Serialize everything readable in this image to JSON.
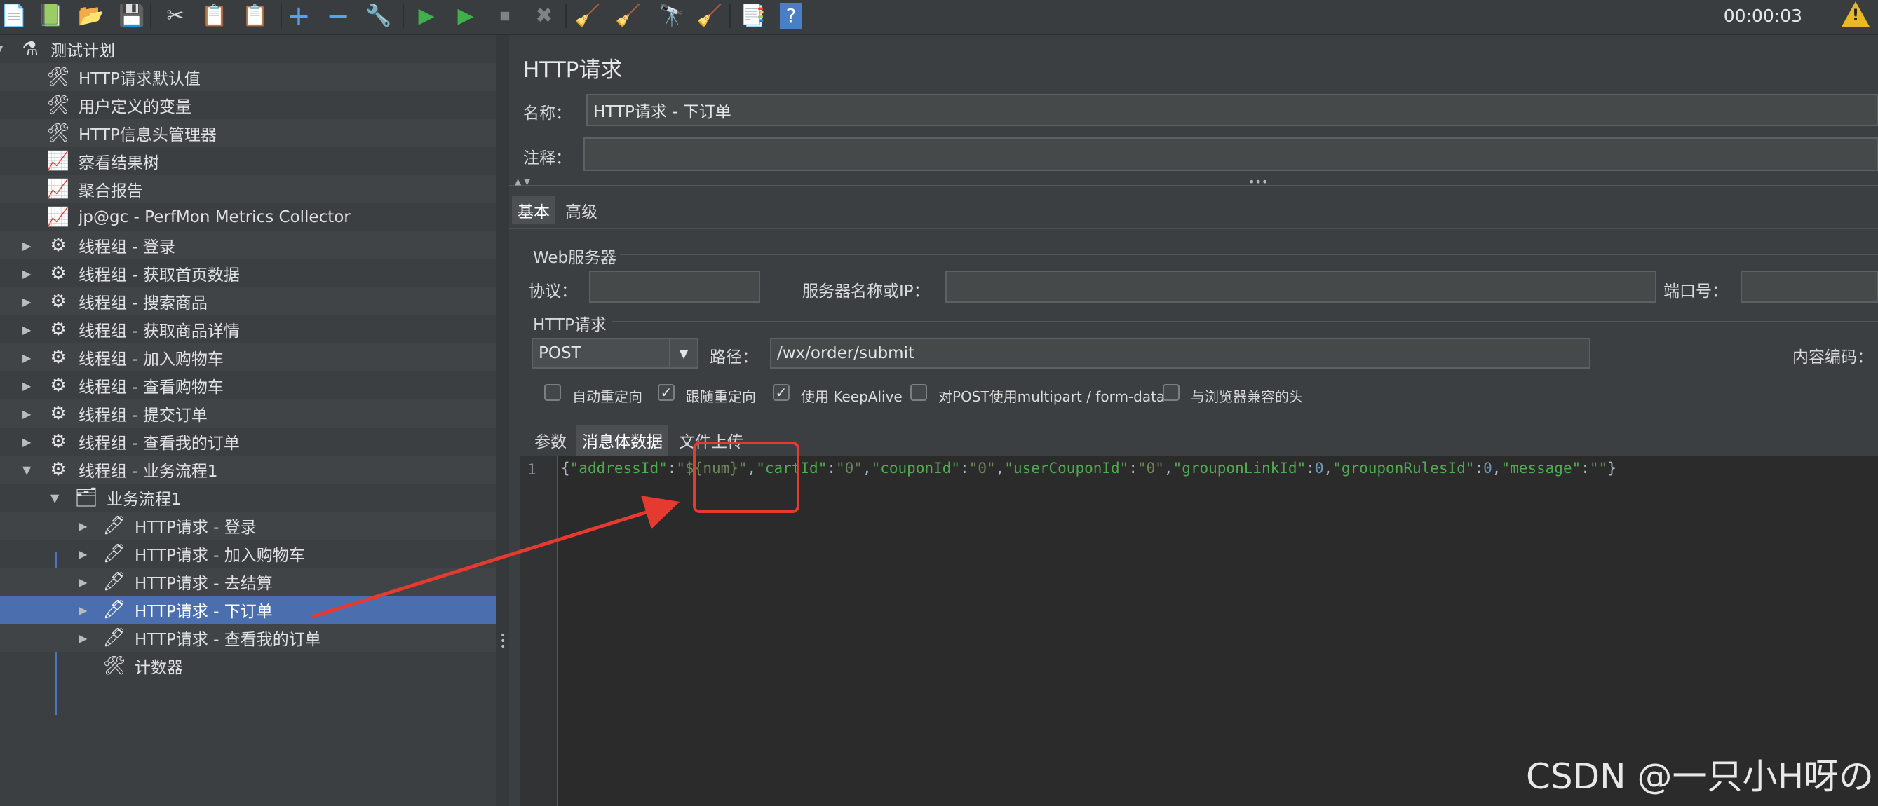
{
  "toolbar": {
    "timer": "00:00:03",
    "warning_badge": "!",
    "buttons": [
      {
        "name": "new-icon",
        "glyph": "📄"
      },
      {
        "name": "templates-icon",
        "glyph": "📗"
      },
      {
        "name": "open-icon",
        "glyph": "📂"
      },
      {
        "name": "save-icon",
        "glyph": "💾"
      },
      {
        "name": "cut-icon",
        "glyph": "✂"
      },
      {
        "name": "copy-icon",
        "glyph": "📋"
      },
      {
        "name": "paste-icon",
        "glyph": "📋"
      },
      {
        "name": "expand-icon",
        "glyph": "+"
      },
      {
        "name": "collapse-icon",
        "glyph": "−"
      },
      {
        "name": "toggle-icon",
        "glyph": "🔧"
      },
      {
        "name": "start-icon",
        "glyph": "▶"
      },
      {
        "name": "start-no-pause-icon",
        "glyph": "▶"
      },
      {
        "name": "stop-icon",
        "glyph": "⏹"
      },
      {
        "name": "shutdown-icon",
        "glyph": "✖"
      },
      {
        "name": "clear-icon",
        "glyph": "🧹"
      },
      {
        "name": "clear-all-icon",
        "glyph": "🧹"
      },
      {
        "name": "search-icon",
        "glyph": "🔭"
      },
      {
        "name": "reset-search-icon",
        "glyph": "🧹"
      },
      {
        "name": "function-helper-icon",
        "glyph": "📑"
      },
      {
        "name": "help-icon",
        "glyph": "?"
      }
    ]
  },
  "tree": {
    "items": [
      {
        "label": "测试计划",
        "icon": "flask-icon",
        "glyph": "⚗",
        "arrow": "▼"
      },
      {
        "label": "HTTP请求默认值",
        "icon": "config-tool-icon",
        "glyph": "🛠",
        "arrow": ""
      },
      {
        "label": "用户定义的变量",
        "icon": "config-tool-icon",
        "glyph": "🛠",
        "arrow": ""
      },
      {
        "label": "HTTP信息头管理器",
        "icon": "config-tool-icon",
        "glyph": "🛠",
        "arrow": ""
      },
      {
        "label": "察看结果树",
        "icon": "listener-chart-icon",
        "glyph": "📈",
        "arrow": ""
      },
      {
        "label": "聚合报告",
        "icon": "listener-chart-icon",
        "glyph": "📈",
        "arrow": ""
      },
      {
        "label": "jp@gc - PerfMon Metrics Collector",
        "icon": "listener-chart-icon",
        "glyph": "📈",
        "arrow": ""
      },
      {
        "label": "线程组 - 登录",
        "icon": "thread-group-gear-icon",
        "glyph": "⚙",
        "arrow": "▶"
      },
      {
        "label": "线程组 - 获取首页数据",
        "icon": "thread-group-gear-icon",
        "glyph": "⚙",
        "arrow": "▶"
      },
      {
        "label": "线程组 - 搜索商品",
        "icon": "thread-group-gear-icon",
        "glyph": "⚙",
        "arrow": "▶"
      },
      {
        "label": "线程组 - 获取商品详情",
        "icon": "thread-group-gear-icon",
        "glyph": "⚙",
        "arrow": "▶"
      },
      {
        "label": "线程组 - 加入购物车",
        "icon": "thread-group-gear-icon",
        "glyph": "⚙",
        "arrow": "▶"
      },
      {
        "label": "线程组 - 查看购物车",
        "icon": "thread-group-gear-icon",
        "glyph": "⚙",
        "arrow": "▶"
      },
      {
        "label": "线程组 - 提交订单",
        "icon": "thread-group-gear-icon",
        "glyph": "⚙",
        "arrow": "▶"
      },
      {
        "label": "线程组 - 查看我的订单",
        "icon": "thread-group-gear-icon",
        "glyph": "⚙",
        "arrow": "▶"
      },
      {
        "label": "线程组 - 业务流程1",
        "icon": "thread-group-gear-icon",
        "glyph": "⚙",
        "arrow": "▼"
      },
      {
        "label": "业务流程1",
        "icon": "transaction-controller-icon",
        "glyph": "🗂",
        "arrow": "▼"
      },
      {
        "label": "HTTP请求 - 登录",
        "icon": "sampler-pipette-icon",
        "glyph": "🖊",
        "arrow": "▶"
      },
      {
        "label": "HTTP请求 - 加入购物车",
        "icon": "sampler-pipette-icon",
        "glyph": "🖊",
        "arrow": "▶"
      },
      {
        "label": "HTTP请求 - 去结算",
        "icon": "sampler-pipette-icon",
        "glyph": "🖊",
        "arrow": "▶"
      },
      {
        "label": "HTTP请求 - 下订单",
        "icon": "sampler-pipette-icon",
        "glyph": "🖊",
        "arrow": "▶"
      },
      {
        "label": "HTTP请求 - 查看我的订单",
        "icon": "sampler-pipette-icon",
        "glyph": "🖊",
        "arrow": "▶"
      },
      {
        "label": "计数器",
        "icon": "config-tool-icon",
        "glyph": "🛠",
        "arrow": ""
      }
    ]
  },
  "panel": {
    "title": "HTTP请求",
    "name_label": "名称：",
    "name_value": "HTTP请求 - 下订单",
    "comment_label": "注释：",
    "comment_value": "",
    "tabs": [
      "基本",
      "高级"
    ],
    "web_server_group": "Web服务器",
    "protocol_label": "协议：",
    "protocol_value": "",
    "server_label": "服务器名称或IP：",
    "server_value": "",
    "port_label": "端口号：",
    "port_value": "",
    "http_request_group": "HTTP请求",
    "method_value": "POST",
    "path_label": "路径：",
    "path_value": "/wx/order/submit",
    "encoding_label": "内容编码：",
    "checkboxes": [
      {
        "label": "自动重定向",
        "checked": false
      },
      {
        "label": "跟随重定向",
        "checked": true
      },
      {
        "label": "使用 KeepAlive",
        "checked": true
      },
      {
        "label": "对POST使用multipart / form-data",
        "checked": false
      },
      {
        "label": "与浏览器兼容的头",
        "checked": false
      }
    ],
    "body_tabs": [
      "参数",
      "消息体数据",
      "文件上传"
    ],
    "line_number": "1",
    "body_tokens": [
      {
        "t": "{",
        "c": "p"
      },
      {
        "t": "\"addressId\"",
        "c": "k"
      },
      {
        "t": ":",
        "c": "p"
      },
      {
        "t": "\"${num}\"",
        "c": "s"
      },
      {
        "t": ",",
        "c": "p"
      },
      {
        "t": "\"cartId\"",
        "c": "k"
      },
      {
        "t": ":",
        "c": "p"
      },
      {
        "t": "\"0\"",
        "c": "s"
      },
      {
        "t": ",",
        "c": "p"
      },
      {
        "t": "\"couponId\"",
        "c": "k"
      },
      {
        "t": ":",
        "c": "p"
      },
      {
        "t": "\"0\"",
        "c": "s"
      },
      {
        "t": ",",
        "c": "p"
      },
      {
        "t": "\"userCouponId\"",
        "c": "k"
      },
      {
        "t": ":",
        "c": "p"
      },
      {
        "t": "\"0\"",
        "c": "s"
      },
      {
        "t": ",",
        "c": "p"
      },
      {
        "t": "\"grouponLinkId\"",
        "c": "k"
      },
      {
        "t": ":",
        "c": "p"
      },
      {
        "t": "0",
        "c": "n"
      },
      {
        "t": ",",
        "c": "p"
      },
      {
        "t": "\"grouponRulesId\"",
        "c": "k"
      },
      {
        "t": ":",
        "c": "p"
      },
      {
        "t": "0",
        "c": "n"
      },
      {
        "t": ",",
        "c": "p"
      },
      {
        "t": "\"message\"",
        "c": "k"
      },
      {
        "t": ":",
        "c": "p"
      },
      {
        "t": "\"\"",
        "c": "s"
      },
      {
        "t": "}",
        "c": "p"
      }
    ]
  },
  "annotation": {
    "color": "#e53a2f",
    "watermark": "CSDN @一只小H呀の"
  },
  "colors": {
    "selection": "#4b6eaf",
    "background": "#3c3f41",
    "editor_bg": "#2b2b2b"
  }
}
